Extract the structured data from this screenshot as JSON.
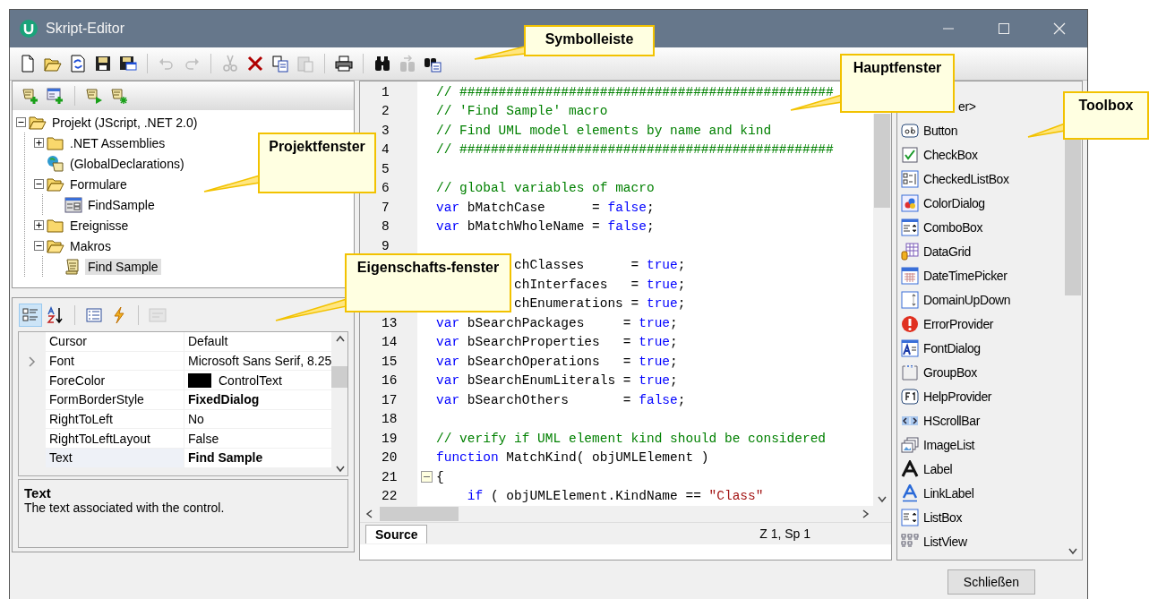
{
  "window": {
    "title": "Skript-Editor"
  },
  "toolbar": {
    "groups": [
      [
        {
          "kind": "new",
          "disabled": false
        },
        {
          "kind": "open",
          "disabled": false
        },
        {
          "kind": "reload",
          "disabled": false
        },
        {
          "kind": "save",
          "disabled": false
        },
        {
          "kind": "save-all",
          "disabled": false
        }
      ],
      [
        {
          "kind": "undo",
          "disabled": true
        },
        {
          "kind": "redo",
          "disabled": true
        }
      ],
      [
        {
          "kind": "cut",
          "disabled": true
        },
        {
          "kind": "delete",
          "disabled": false
        },
        {
          "kind": "copy",
          "disabled": false
        },
        {
          "kind": "paste",
          "disabled": true
        }
      ],
      [
        {
          "kind": "print",
          "disabled": false
        }
      ],
      [
        {
          "kind": "find",
          "disabled": false
        },
        {
          "kind": "find-next",
          "disabled": true
        },
        {
          "kind": "replace",
          "disabled": false
        }
      ]
    ]
  },
  "project": {
    "toolbar": [
      [
        {
          "kind": "script-add"
        },
        {
          "kind": "form-add"
        }
      ],
      [
        {
          "kind": "script-run"
        },
        {
          "kind": "script-new"
        }
      ]
    ],
    "tree": [
      {
        "label": "Projekt (JScript, .NET 2.0)",
        "kind": "folder",
        "expanded": true,
        "selected": false,
        "children": [
          {
            "label": ".NET Assemblies",
            "kind": "folder",
            "expanded": false,
            "selected": false
          },
          {
            "label": "(GlobalDeclarations)",
            "kind": "globe-script",
            "selected": false
          },
          {
            "label": "Formulare",
            "kind": "folder",
            "expanded": true,
            "selected": false,
            "children": [
              {
                "label": "FindSample",
                "kind": "form",
                "selected": false
              }
            ]
          },
          {
            "label": "Ereignisse",
            "kind": "folder",
            "expanded": false,
            "selected": false
          },
          {
            "label": "Makros",
            "kind": "folder",
            "expanded": true,
            "selected": false,
            "children": [
              {
                "label": "Find Sample",
                "kind": "script",
                "selected": true
              }
            ]
          }
        ]
      }
    ]
  },
  "properties": {
    "toolbar": [
      [
        {
          "kind": "categorized",
          "selected": true,
          "disabled": false
        },
        {
          "kind": "alphabetical",
          "selected": false,
          "disabled": false
        }
      ],
      [
        {
          "kind": "properties",
          "selected": false,
          "disabled": false
        },
        {
          "kind": "events",
          "selected": false,
          "disabled": false
        }
      ],
      [
        {
          "kind": "pages",
          "selected": false,
          "disabled": true
        }
      ]
    ],
    "rows": [
      {
        "name": "Cursor",
        "value": "Default",
        "bold": false,
        "expandable": false,
        "selected": false
      },
      {
        "name": "Font",
        "value": "Microsoft Sans Serif, 8.25",
        "bold": false,
        "expandable": true,
        "selected": false
      },
      {
        "name": "ForeColor",
        "value": "ControlText",
        "bold": false,
        "expandable": false,
        "selected": false,
        "color": "#000000"
      },
      {
        "name": "FormBorderStyle",
        "value": "FixedDialog",
        "bold": true,
        "expandable": false,
        "selected": false
      },
      {
        "name": "RightToLeft",
        "value": "No",
        "bold": false,
        "expandable": false,
        "selected": false
      },
      {
        "name": "RightToLeftLayout",
        "value": "False",
        "bold": false,
        "expandable": false,
        "selected": false
      },
      {
        "name": "Text",
        "value": "Find Sample",
        "bold": true,
        "expandable": false,
        "selected": true
      }
    ],
    "description": {
      "title": "Text",
      "text": "The text associated with the control."
    }
  },
  "editor": {
    "lines": [
      {
        "number": "1",
        "fold": false,
        "tokens": [
          {
            "kind": "comment",
            "text": "// ################################################"
          }
        ]
      },
      {
        "number": "2",
        "fold": false,
        "tokens": [
          {
            "kind": "comment",
            "text": "// 'Find Sample' macro"
          }
        ]
      },
      {
        "number": "3",
        "fold": false,
        "tokens": [
          {
            "kind": "comment",
            "text": "// Find UML model elements by name and kind"
          }
        ]
      },
      {
        "number": "4",
        "fold": false,
        "tokens": [
          {
            "kind": "comment",
            "text": "// ################################################"
          }
        ]
      },
      {
        "number": "5",
        "fold": false
      },
      {
        "number": "6",
        "fold": false,
        "tokens": [
          {
            "kind": "comment",
            "text": "// global variables of macro"
          }
        ]
      },
      {
        "number": "7",
        "fold": false,
        "tokens": [
          {
            "kind": "keyword",
            "text": "var"
          },
          {
            "kind": "plain",
            "text": " bMatchCase      = "
          },
          {
            "kind": "keyword",
            "text": "false"
          },
          {
            "kind": "plain",
            "text": ";"
          }
        ]
      },
      {
        "number": "8",
        "fold": false,
        "tokens": [
          {
            "kind": "keyword",
            "text": "var"
          },
          {
            "kind": "plain",
            "text": " bMatchWholeName = "
          },
          {
            "kind": "keyword",
            "text": "false"
          },
          {
            "kind": "plain",
            "text": ";"
          }
        ]
      },
      {
        "number": "9",
        "fold": false
      },
      {
        "partial": true,
        "fold": false,
        "tokens": [
          {
            "kind": "plain",
            "text": "chClasses      = "
          },
          {
            "kind": "keyword",
            "text": "true"
          },
          {
            "kind": "plain",
            "text": ";"
          }
        ]
      },
      {
        "partial": true,
        "fold": false,
        "tokens": [
          {
            "kind": "plain",
            "text": "chInterfaces   = "
          },
          {
            "kind": "keyword",
            "text": "true"
          },
          {
            "kind": "plain",
            "text": ";"
          }
        ]
      },
      {
        "partial": true,
        "fold": false,
        "tokens": [
          {
            "kind": "plain",
            "text": "chEnumerations = "
          },
          {
            "kind": "keyword",
            "text": "true"
          },
          {
            "kind": "plain",
            "text": ";"
          }
        ]
      },
      {
        "number": "13",
        "fold": false,
        "tokens": [
          {
            "kind": "keyword",
            "text": "var"
          },
          {
            "kind": "plain",
            "text": " bSearchPackages     = "
          },
          {
            "kind": "keyword",
            "text": "true"
          },
          {
            "kind": "plain",
            "text": ";"
          }
        ]
      },
      {
        "number": "14",
        "fold": false,
        "tokens": [
          {
            "kind": "keyword",
            "text": "var"
          },
          {
            "kind": "plain",
            "text": " bSearchProperties   = "
          },
          {
            "kind": "keyword",
            "text": "true"
          },
          {
            "kind": "plain",
            "text": ";"
          }
        ]
      },
      {
        "number": "15",
        "fold": false,
        "tokens": [
          {
            "kind": "keyword",
            "text": "var"
          },
          {
            "kind": "plain",
            "text": " bSearchOperations   = "
          },
          {
            "kind": "keyword",
            "text": "true"
          },
          {
            "kind": "plain",
            "text": ";"
          }
        ]
      },
      {
        "number": "16",
        "fold": false,
        "tokens": [
          {
            "kind": "keyword",
            "text": "var"
          },
          {
            "kind": "plain",
            "text": " bSearchEnumLiterals = "
          },
          {
            "kind": "keyword",
            "text": "true"
          },
          {
            "kind": "plain",
            "text": ";"
          }
        ]
      },
      {
        "number": "17",
        "fold": false,
        "tokens": [
          {
            "kind": "keyword",
            "text": "var"
          },
          {
            "kind": "plain",
            "text": " bSearchOthers       = "
          },
          {
            "kind": "keyword",
            "text": "false"
          },
          {
            "kind": "plain",
            "text": ";"
          }
        ]
      },
      {
        "number": "18",
        "fold": false
      },
      {
        "number": "19",
        "fold": false,
        "tokens": [
          {
            "kind": "comment",
            "text": "// verify if UML element kind should be considered"
          }
        ]
      },
      {
        "number": "20",
        "fold": false,
        "tokens": [
          {
            "kind": "keyword",
            "text": "function"
          },
          {
            "kind": "plain",
            "text": " MatchKind( objUMLElement )"
          }
        ]
      },
      {
        "number": "21",
        "fold": true,
        "tokens": [
          {
            "kind": "plain",
            "text": "{"
          }
        ]
      },
      {
        "number": "22",
        "fold": false,
        "tokens": [
          {
            "kind": "keyword",
            "text": "    if"
          },
          {
            "kind": "plain",
            "text": " ( objUMLElement.KindName == "
          },
          {
            "kind": "string",
            "text": "\"Class\""
          }
        ]
      }
    ],
    "tabs": [
      {
        "label": "Source",
        "selected": true
      }
    ],
    "position": "Z 1, Sp 1"
  },
  "toolbox": {
    "items": [
      {
        "label": "er>",
        "kind": "partial"
      },
      {
        "label": "Button",
        "kind": "button"
      },
      {
        "label": "CheckBox",
        "kind": "checkbox"
      },
      {
        "label": "CheckedListBox",
        "kind": "checkedlistbox"
      },
      {
        "label": "ColorDialog",
        "kind": "colordialog"
      },
      {
        "label": "ComboBox",
        "kind": "combobox"
      },
      {
        "label": "DataGrid",
        "kind": "datagrid"
      },
      {
        "label": "DateTimePicker",
        "kind": "datetimepicker"
      },
      {
        "label": "DomainUpDown",
        "kind": "domainupdown"
      },
      {
        "label": "ErrorProvider",
        "kind": "errorprovider"
      },
      {
        "label": "FontDialog",
        "kind": "fontdialog"
      },
      {
        "label": "GroupBox",
        "kind": "groupbox"
      },
      {
        "label": "HelpProvider",
        "kind": "helpprovider"
      },
      {
        "label": "HScrollBar",
        "kind": "hscrollbar"
      },
      {
        "label": "ImageList",
        "kind": "imagelist"
      },
      {
        "label": "Label",
        "kind": "label"
      },
      {
        "label": "LinkLabel",
        "kind": "linklabel"
      },
      {
        "label": "ListBox",
        "kind": "listbox"
      },
      {
        "label": "ListView",
        "kind": "listview"
      }
    ]
  },
  "footer": {
    "close_button": "Schließen"
  },
  "callouts": [
    {
      "text": "Symbolleiste"
    },
    {
      "text": "Hauptfenster"
    },
    {
      "text": "Toolbox"
    },
    {
      "text": "Projektfenster"
    },
    {
      "text": "Eigenschafts-fenster"
    }
  ]
}
